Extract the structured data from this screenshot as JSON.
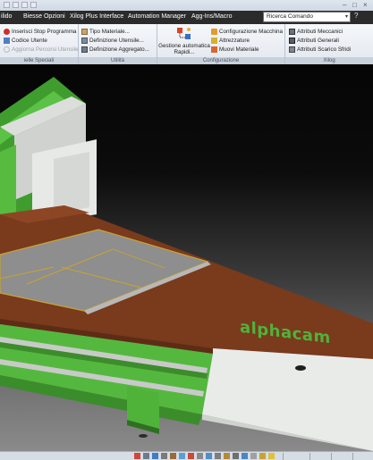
{
  "menubar": {
    "items": [
      {
        "label": "ilido"
      },
      {
        "label": "Biesse Opzioni"
      },
      {
        "label": "Xilog Plus Interface"
      },
      {
        "label": "Automation Manager"
      },
      {
        "label": "Agg-Ins/Macro"
      }
    ],
    "search_value": "Ricerca Comando",
    "help_label": "?"
  },
  "ribbon": {
    "group_speciali": {
      "title": "ielle Speciali",
      "buttons": [
        {
          "label": "Inserisci Stop Programma"
        },
        {
          "label": "Codice Utente"
        },
        {
          "label": "Aggiorna Percorsi Utensile"
        }
      ]
    },
    "group_utilita": {
      "title": "Utilità",
      "buttons": [
        {
          "label": "Tipo Materiale..."
        },
        {
          "label": "Definizione Utensile..."
        },
        {
          "label": "Definizione Aggregato..."
        }
      ]
    },
    "group_configurazione": {
      "title": "Configurazione",
      "big_button": {
        "label_line1": "Gestione automatica",
        "label_line2": "Rapidi..."
      },
      "buttons": [
        {
          "label": "Configurazione Macchina"
        },
        {
          "label": "Attrezzature"
        },
        {
          "label": "Muovi Materiale"
        }
      ]
    },
    "group_xilog": {
      "title": "Xilog",
      "buttons": [
        {
          "label": "Attributi Meccanici"
        },
        {
          "label": "Attributi Generali"
        },
        {
          "label": "Attributi Scarico Sfridi"
        }
      ]
    }
  },
  "viewport": {
    "brand_text": "alphacam"
  },
  "colors": {
    "machine_green": "#4fb33a",
    "table_brown": "#7a3a1c",
    "machine_white": "#e9ebe9",
    "panel_gray": "#8e8f8e",
    "ribbon_bg": "#eef1f5",
    "menubar_bg": "#2b2b2b"
  }
}
